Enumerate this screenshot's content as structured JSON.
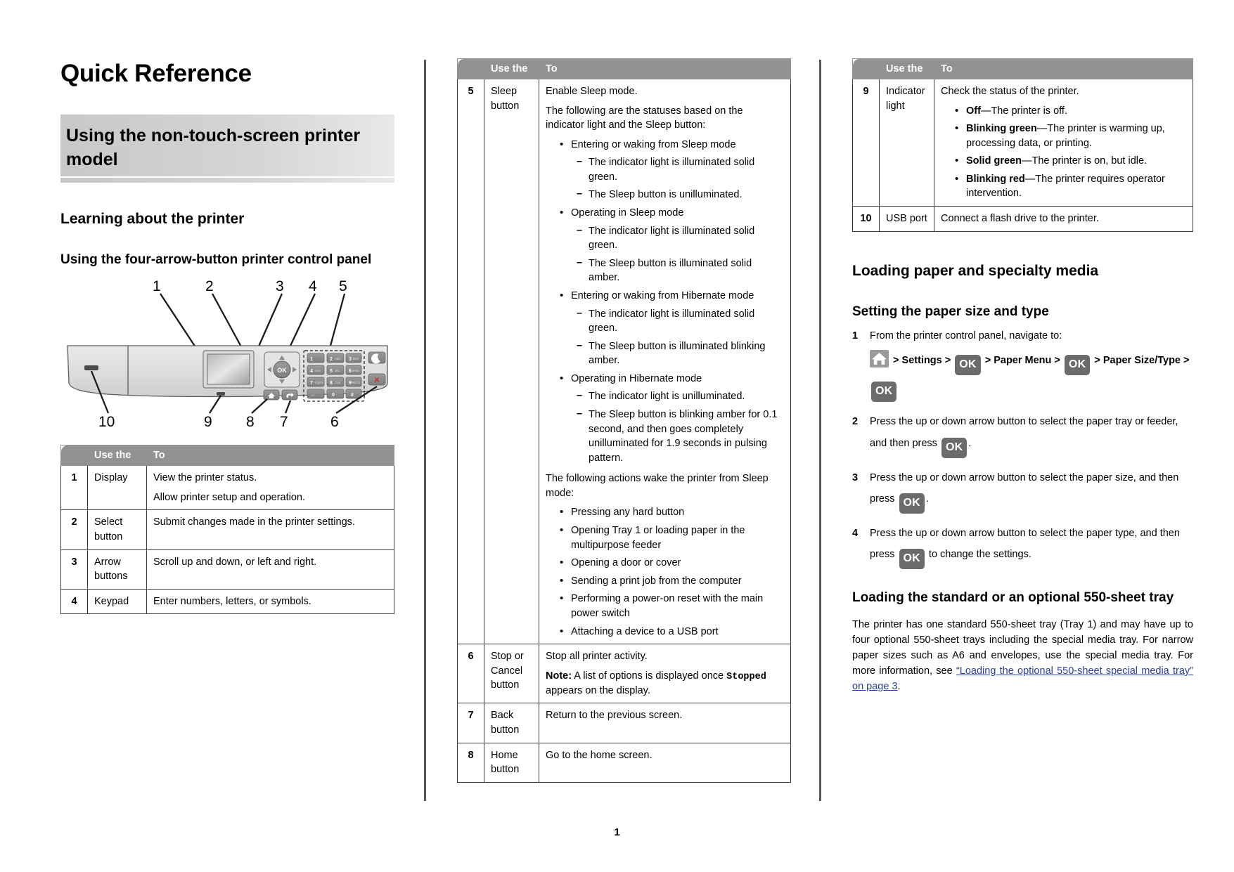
{
  "document": {
    "title": "Quick Reference",
    "banner_title": "Using the non-touch-screen printer model",
    "page_number": "1"
  },
  "left_column": {
    "section_heading": "Learning about the printer",
    "subsection_heading": "Using the four-arrow-button printer control panel",
    "diagram": {
      "callouts_top": [
        "1",
        "2",
        "3",
        "4",
        "5"
      ],
      "callouts_bottom": [
        "10",
        "9",
        "8",
        "7",
        "6"
      ]
    },
    "table": {
      "headers": [
        "",
        "Use the",
        "To"
      ],
      "rows": [
        {
          "num": "1",
          "use": "Display",
          "to": [
            "View the printer status.",
            "Allow printer setup and operation."
          ]
        },
        {
          "num": "2",
          "use": "Select button",
          "to": [
            "Submit changes made in the printer settings."
          ]
        },
        {
          "num": "3",
          "use": "Arrow buttons",
          "to": [
            "Scroll up and down, or left and right."
          ]
        },
        {
          "num": "4",
          "use": "Keypad",
          "to": [
            "Enter numbers, letters, or symbols."
          ]
        }
      ]
    }
  },
  "middle_column": {
    "table": {
      "headers": [
        "",
        "Use the",
        "To"
      ],
      "row5": {
        "num": "5",
        "use": "Sleep button",
        "intro1": "Enable Sleep mode.",
        "intro2": "The following are the statuses based on the indicator light and the Sleep button:",
        "bullets": [
          {
            "label": "Entering or waking from Sleep mode",
            "sub": [
              "The indicator light is illuminated solid green.",
              "The Sleep button is unilluminated."
            ]
          },
          {
            "label": "Operating in Sleep mode",
            "sub": [
              "The indicator light is illuminated solid green.",
              "The Sleep button is illuminated solid amber."
            ]
          },
          {
            "label": "Entering or waking from Hibernate mode",
            "sub": [
              "The indicator light is illuminated solid green.",
              "The Sleep button is illuminated blinking amber."
            ]
          },
          {
            "label": "Operating in Hibernate mode",
            "sub": [
              "The indicator light is unilluminated.",
              "The Sleep button is blinking amber for 0.1 second, and then goes completely unilluminated for 1.9 seconds in pulsing pattern."
            ]
          }
        ],
        "wake_intro": "The following actions wake the printer from Sleep mode:",
        "wake_bullets": [
          "Pressing any hard button",
          "Opening Tray 1 or loading paper in the multipurpose feeder",
          "Opening a door or cover",
          "Sending a print job from the computer",
          "Performing a power-on reset with the main power switch",
          "Attaching a device to a USB port"
        ]
      },
      "row6": {
        "num": "6",
        "use": "Stop or Cancel button",
        "line1": "Stop all printer activity.",
        "note_label": "Note:",
        "note_part1": " A list of options is displayed once ",
        "note_mono": "Stopped",
        "note_part2": " appears on the display."
      },
      "row7": {
        "num": "7",
        "use": "Back button",
        "to": "Return to the previous screen."
      },
      "row8": {
        "num": "8",
        "use": "Home button",
        "to": "Go to the home screen."
      }
    }
  },
  "right_column": {
    "table": {
      "headers": [
        "",
        "Use the",
        "To"
      ],
      "row9": {
        "num": "9",
        "use": "Indicator light",
        "intro": "Check the status of the printer.",
        "bullets": [
          {
            "bold": "Off",
            "rest": "—The printer is off."
          },
          {
            "bold": "Blinking green",
            "rest": "—The printer is warming up, processing data, or printing."
          },
          {
            "bold": "Solid green",
            "rest": "—The printer is on, but idle."
          },
          {
            "bold": "Blinking red",
            "rest": "—The printer requires operator intervention."
          }
        ]
      },
      "row10": {
        "num": "10",
        "use": "USB port",
        "to": "Connect a flash drive to the printer."
      }
    },
    "heading_loading": "Loading paper and specialty media",
    "subheading_setting": "Setting the paper size and type",
    "steps": {
      "step1_text": "From the printer control panel, navigate to:",
      "nav": {
        "home_icon": "home-icon",
        "settings": "Settings",
        "ok1": "OK",
        "paper_menu": "Paper Menu",
        "ok2": "OK",
        "paper_size_type": "Paper Size/Type",
        "ok3": "OK",
        "sep": ">"
      },
      "step2_a": "Press the up or down arrow button to select the paper tray or feeder, and then press ",
      "step2_ok": "OK",
      "step2_b": ".",
      "step3_a": "Press the up or down arrow button to select the paper size, and then press ",
      "step3_ok": "OK",
      "step3_b": ".",
      "step4_a": "Press the up or down arrow button to select the paper type, and then press ",
      "step4_ok": "OK",
      "step4_b": " to change the settings."
    },
    "subheading_tray": "Loading the standard or an optional 550-sheet tray",
    "tray_paragraph_1": "The printer has one standard 550-sheet tray (Tray 1) and may have up to four optional 550-sheet trays including the special media tray. For narrow paper sizes such as A6 and envelopes, use the special media tray. For more information, see ",
    "tray_link": "“Loading the optional 550-sheet special media tray” on page 3",
    "tray_paragraph_2": "."
  },
  "colors": {
    "header_gray": "#929292",
    "rule_gray": "#58585a",
    "link_blue": "#2a3fa8",
    "key_gray": "#6b6b6b"
  }
}
